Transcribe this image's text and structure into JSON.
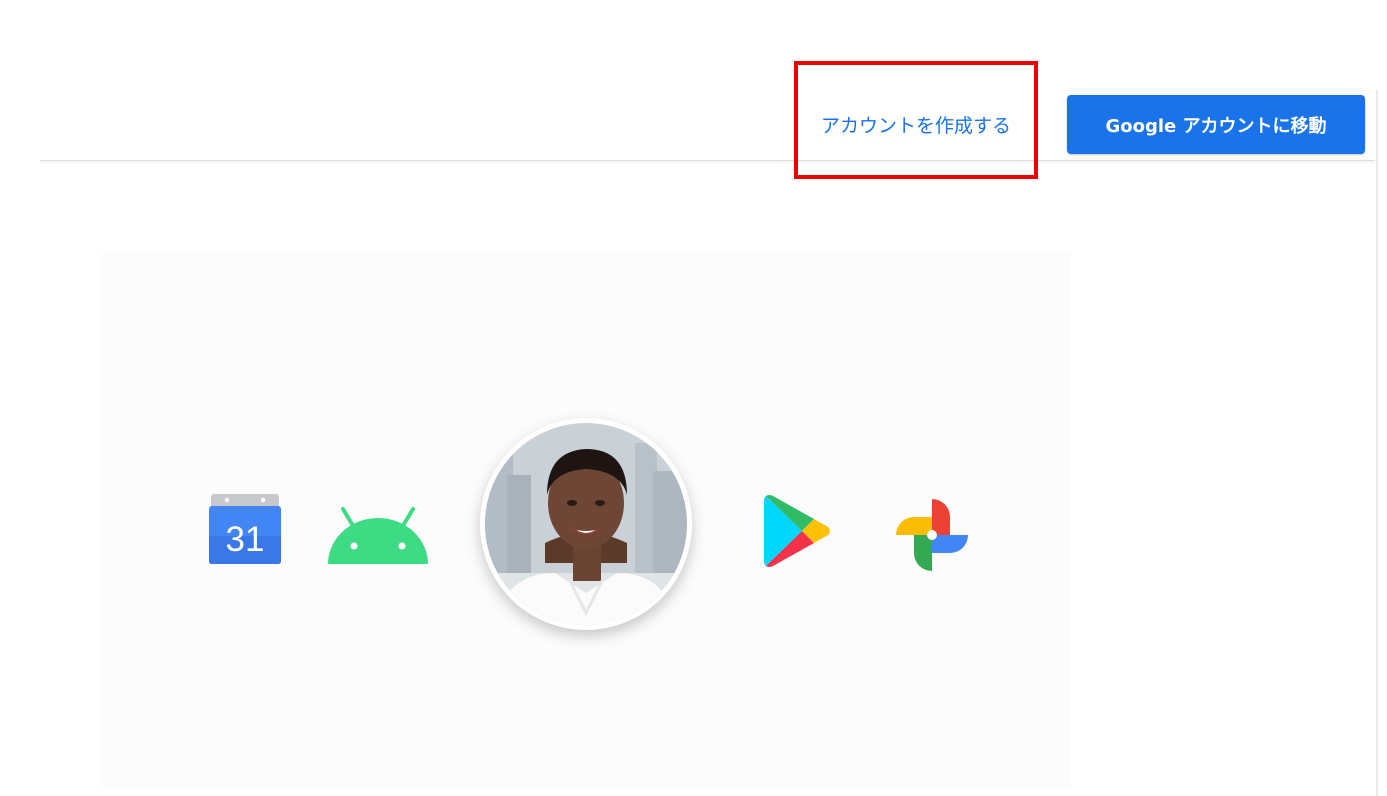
{
  "header": {
    "create_account_label": "アカウントを作成する",
    "goto_account_label": "Google アカウントに移動",
    "accent_color": "#1a73e8",
    "highlight_color": "#ee0000"
  },
  "hero": {
    "icons": [
      {
        "name": "calendar-icon",
        "text": "31"
      },
      {
        "name": "android-icon"
      },
      {
        "name": "avatar"
      },
      {
        "name": "play-store-icon"
      },
      {
        "name": "photos-icon"
      }
    ]
  }
}
